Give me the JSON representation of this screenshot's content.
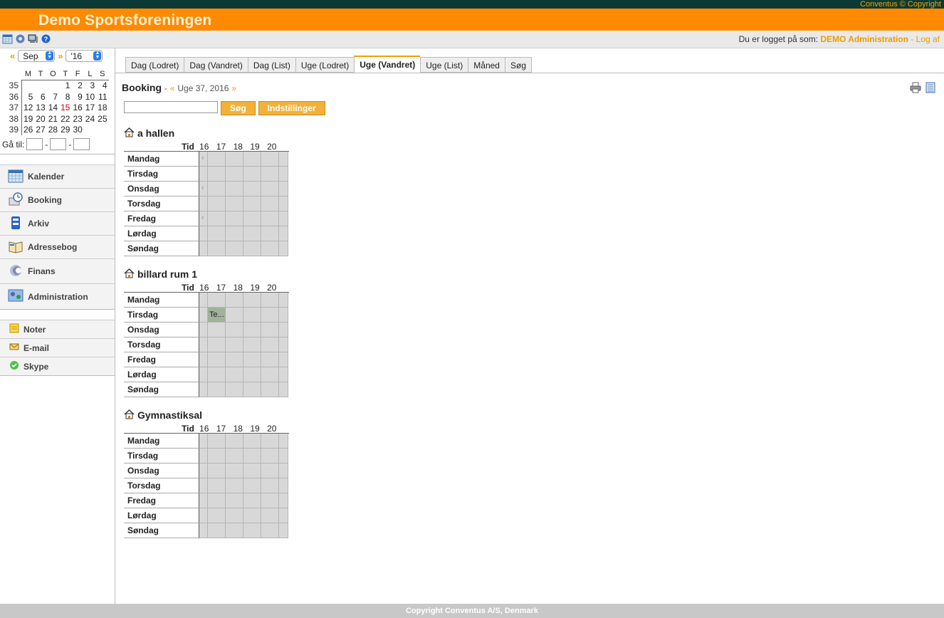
{
  "header": {
    "copyright_top": "Conventus © Copyright",
    "brand": "Demo Sportsforeningen"
  },
  "toolbar": {
    "icons": [
      "calendar-icon",
      "settings-icon",
      "computer-icon",
      "help-icon"
    ],
    "login_prefix": "Du er logget på som:",
    "user": "DEMO Administration",
    "separator": "-",
    "logout": "Log af"
  },
  "calendar": {
    "prev": "«",
    "next": "»",
    "month": "Sep",
    "year": "'16",
    "weekdays": [
      "M",
      "T",
      "O",
      "T",
      "F",
      "L",
      "S"
    ],
    "weeks": [
      {
        "wk": "35",
        "days": [
          "",
          "",
          "",
          "1",
          "2",
          "3",
          "4"
        ]
      },
      {
        "wk": "36",
        "days": [
          "5",
          "6",
          "7",
          "8",
          "9",
          "10",
          "11"
        ]
      },
      {
        "wk": "37",
        "days": [
          "12",
          "13",
          "14",
          "15",
          "16",
          "17",
          "18"
        ]
      },
      {
        "wk": "38",
        "days": [
          "19",
          "20",
          "21",
          "22",
          "23",
          "24",
          "25"
        ]
      },
      {
        "wk": "39",
        "days": [
          "26",
          "27",
          "28",
          "29",
          "30",
          "",
          ""
        ]
      }
    ],
    "today": "15",
    "goto_label": "Gå til:",
    "goto_sep": "-"
  },
  "nav": {
    "main": [
      {
        "label": "Kalender",
        "icon": "calendar-icon"
      },
      {
        "label": "Booking",
        "icon": "booking-icon"
      },
      {
        "label": "Arkiv",
        "icon": "archive-icon"
      },
      {
        "label": "Adressebog",
        "icon": "addressbook-icon"
      },
      {
        "label": "Finans",
        "icon": "finance-icon"
      },
      {
        "label": "Administration",
        "icon": "admin-icon"
      }
    ],
    "extra": [
      {
        "label": "Noter",
        "icon": "note-icon"
      },
      {
        "label": "E-mail",
        "icon": "mail-icon"
      },
      {
        "label": "Skype",
        "icon": "skype-icon"
      }
    ]
  },
  "tabs": [
    "Dag (Lodret)",
    "Dag (Vandret)",
    "Dag (List)",
    "Uge (Lodret)",
    "Uge (Vandret)",
    "Uge (List)",
    "Måned",
    "Søg"
  ],
  "active_tab": "Uge (Vandret)",
  "page": {
    "title": "Booking",
    "dash": "-",
    "prev": "«",
    "week": "Uge 37, 2016",
    "next": "»",
    "search_placeholder": "",
    "search_button": "Søg",
    "settings_button": "Indstillinger"
  },
  "grid": {
    "tid_label": "Tid",
    "hours": [
      "16",
      "17",
      "18",
      "19",
      "20"
    ],
    "days": [
      "Mandag",
      "Tirsdag",
      "Onsdag",
      "Torsdag",
      "Fredag",
      "Lørdag",
      "Søndag"
    ]
  },
  "resources": [
    {
      "name": "a hallen",
      "chevrons": [
        0,
        2,
        4
      ],
      "bookings": []
    },
    {
      "name": "billard rum 1",
      "chevrons": [],
      "bookings": [
        {
          "day": 1,
          "hour": "16",
          "label": "Te..."
        }
      ]
    },
    {
      "name": "Gymnastiksal",
      "chevrons": [],
      "bookings": []
    }
  ],
  "footer": "Copyright Conventus A/S, Denmark"
}
